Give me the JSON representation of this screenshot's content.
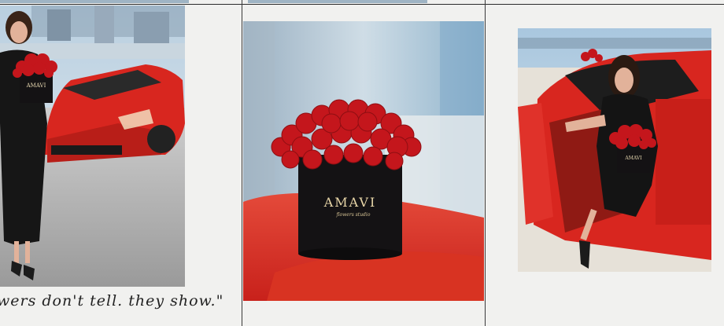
{
  "caption": {
    "text": "wers don't tell. they show.\""
  },
  "photos": [
    {
      "id": "left",
      "box_logo": "AMAVI",
      "alt": "Woman holding red rose box in front of red sports car"
    },
    {
      "id": "center",
      "box_logo": "AMAVI",
      "box_script": "flowers studio",
      "alt": "Black AMAVI box of red roses on a red car"
    },
    {
      "id": "right",
      "box_logo": "AMAVI",
      "alt": "Woman seated in red sports car holding rose box"
    }
  ],
  "colors": {
    "background": "#f1f1ef",
    "rose": "#c4161c",
    "car": "#d8261f",
    "box": "#141214",
    "divider": "#3a3a3a"
  }
}
